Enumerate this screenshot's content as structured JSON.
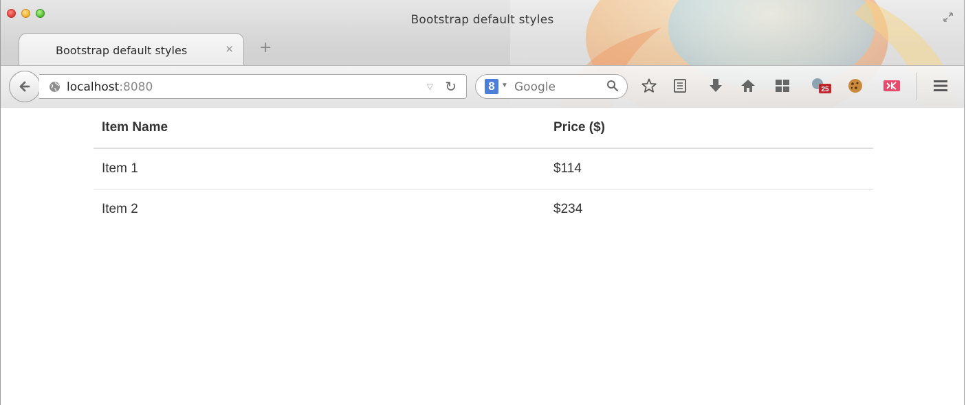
{
  "window": {
    "title": "Bootstrap default styles"
  },
  "tabs": [
    {
      "label": "Bootstrap default styles",
      "close": "×"
    }
  ],
  "new_tab_label": "+",
  "address_bar": {
    "host": "localhost",
    "port": ":8080"
  },
  "search_bar": {
    "engine_letter": "8",
    "placeholder": "Google"
  },
  "toolbar_icons": [
    "bookmark-star-icon",
    "reading-list-icon",
    "downloads-icon",
    "home-icon",
    "apps-grid-icon",
    "calendar-badge-icon",
    "cookie-icon",
    "klout-icon",
    "menu-icon"
  ],
  "badge": {
    "count": "25"
  },
  "table": {
    "headers": [
      "Item Name",
      "Price ($)"
    ],
    "rows": [
      [
        "Item 1",
        "$114"
      ],
      [
        "Item 2",
        "$234"
      ]
    ]
  },
  "colors": {
    "accent_blue": "#4b7fd9",
    "border": "#dddddd",
    "text": "#333333"
  }
}
